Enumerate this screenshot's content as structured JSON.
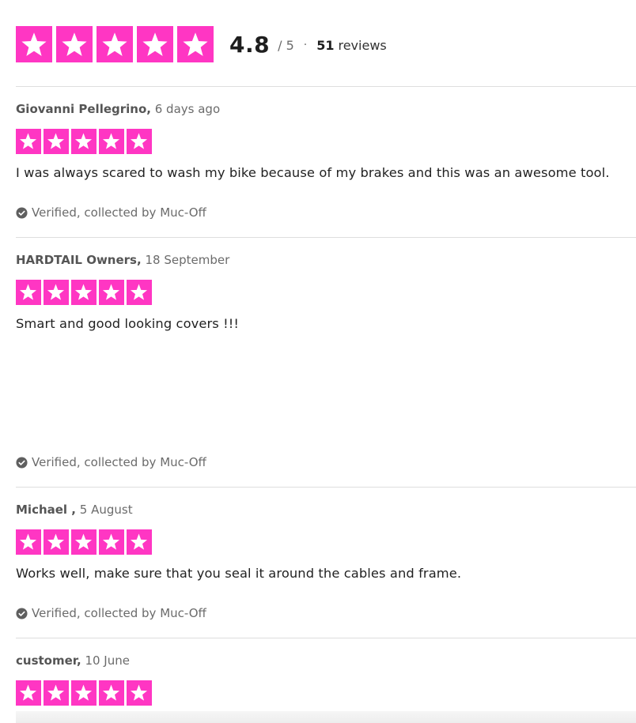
{
  "summary": {
    "score": "4.8",
    "out_of": "/ 5",
    "separator": "·",
    "review_count": "51",
    "review_count_label": "reviews",
    "star_count": 5,
    "star_color": "#ff36c3"
  },
  "reviews": [
    {
      "author": "Giovanni Pellegrino,",
      "date": "6 days ago",
      "rating": 5,
      "text": "I was always scared to wash my bike because of my brakes and this was an awesome tool.",
      "verified": "Verified, collected by Muc-Off"
    },
    {
      "author": "HARDTAIL Owners,",
      "date": "18 September",
      "rating": 5,
      "text": "Smart and good looking covers !!!",
      "verified": "Verified, collected by Muc-Off"
    },
    {
      "author": "Michael ,",
      "date": "5 August",
      "rating": 5,
      "text": "Works well, make sure that you seal it around the cables and frame.",
      "verified": "Verified, collected by Muc-Off"
    },
    {
      "author": "customer,",
      "date": "10 June",
      "rating": 5
    }
  ],
  "icons": {
    "star": "star-icon",
    "verified": "check-circle-icon"
  }
}
